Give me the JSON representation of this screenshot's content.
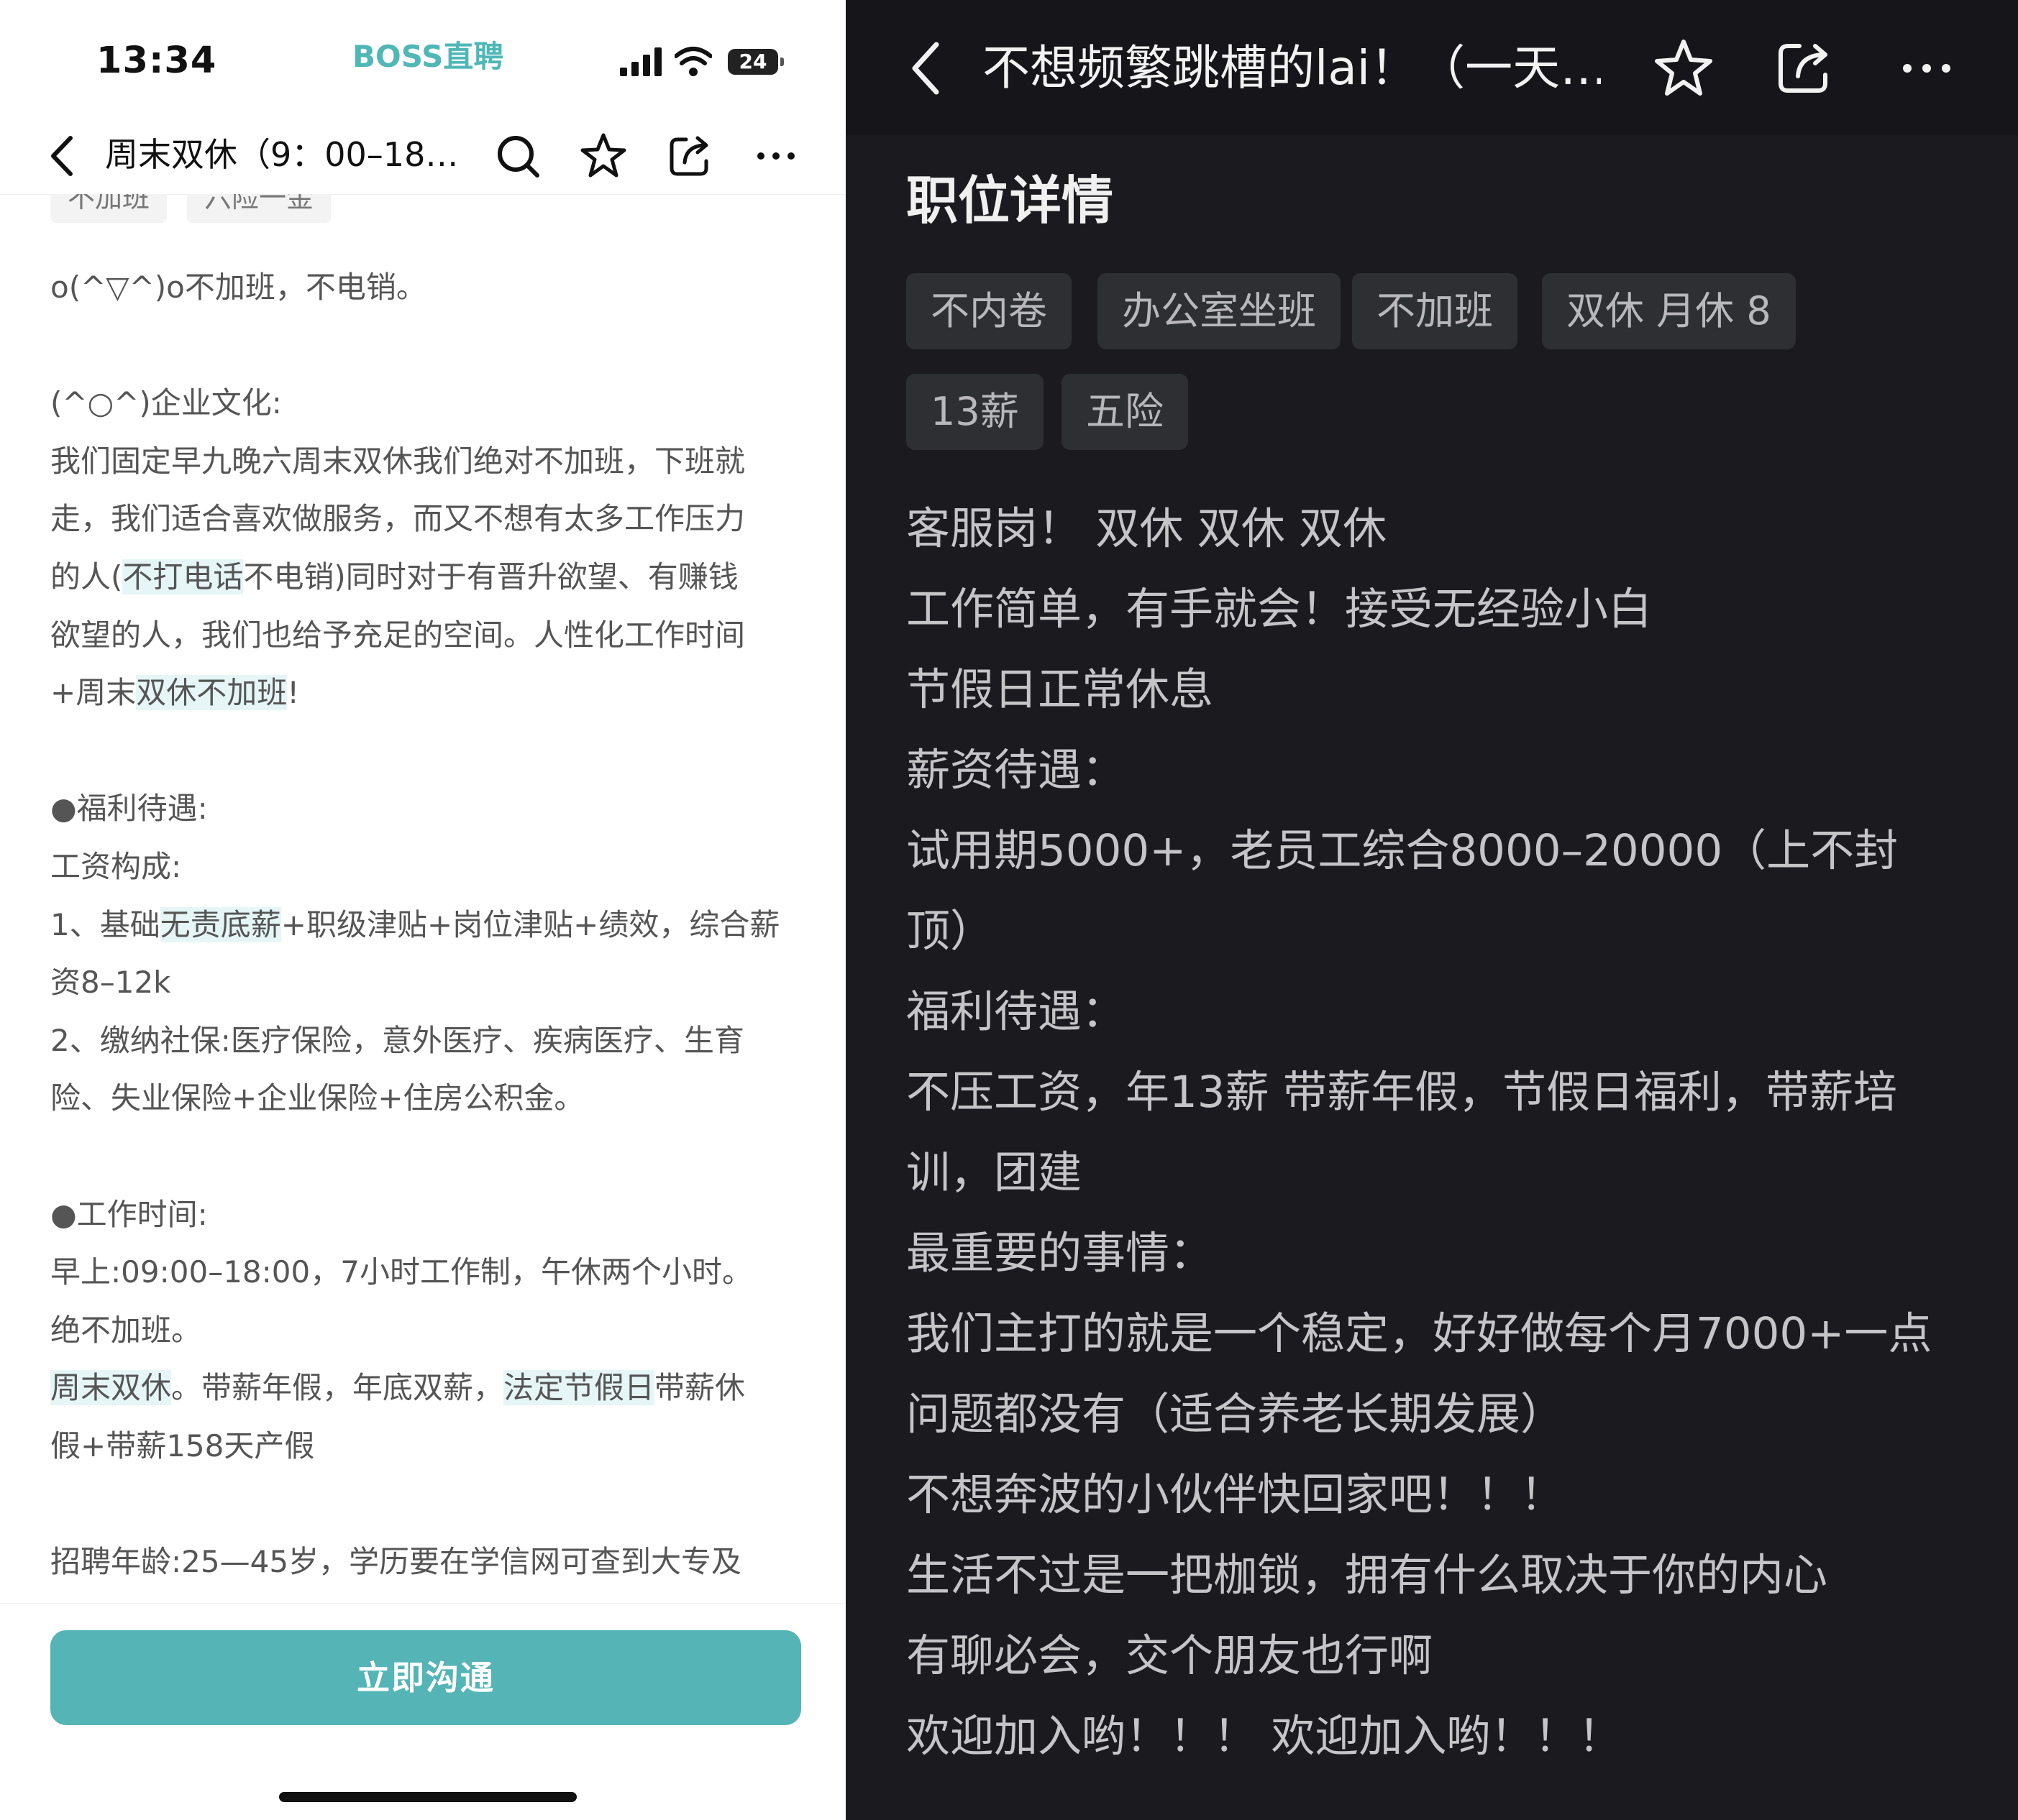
{
  "left": {
    "status_bar": {
      "time": "13:34",
      "brand": "BOSS直聘",
      "battery": "24"
    },
    "nav": {
      "title": "周末双休（9：00–18…"
    },
    "tags_partial": [
      "不加班",
      "六险一金"
    ],
    "lines": [
      "o(^▽^)o不加班，不电销。",
      "",
      "(^○^)企业文化:",
      "我们固定早九晚六周末双休我们绝对不加班，下班就",
      "走，我们适合喜欢做服务，而又不想有太多工作压力",
      "的人(不打电话不电销)同时对于有晋升欲望、有赚钱",
      "欲望的人，我们也给予充足的空间。人性化工作时间",
      "+周末双休不加班!",
      "",
      "●福利待遇:",
      "工资构成:",
      "1、基础无责底薪+职级津贴+岗位津贴+绩效，综合薪",
      "资8–12k",
      "2、缴纳社保:医疗保险，意外医疗、疾病医疗、生育",
      "险、失业保险+企业保险+住房公积金。",
      "",
      "●工作时间:",
      "早上:09:00–18:00，7小时工作制，午休两个小时。",
      "绝不加班。",
      "周末双休。带薪年假，年底双薪，法定节假日带薪休",
      "假+带薪158天产假",
      "",
      "招聘年龄:25—45岁，学历要在学信网可查到大专及"
    ],
    "highlights": {
      "h5a": "的人(",
      "h5b": "不打电话",
      "h5c": "不电销)同时对于有晋升欲望、有赚钱",
      "h7a": "+周末",
      "h7b": "双休不加班",
      "h7c": "!",
      "h11a": "1、基础",
      "h11b": "无责底薪",
      "h11c": "+职级津贴+岗位津贴+绩效，综合薪",
      "h19a": "周末双休",
      "h19b": "。带薪年假，年底双薪，",
      "h19c": "法定节假日",
      "h19d": "带薪休"
    },
    "button": {
      "label": "立即沟通"
    }
  },
  "right": {
    "nav": {
      "title": "不想频繁跳槽的lai！（一天…"
    },
    "section_title": "职位详情",
    "tags": [
      "不内卷",
      "办公室坐班",
      "不加班",
      "双休 月休 8",
      "13薪",
      "五险"
    ],
    "lines": [
      "客服岗！ 双休 双休 双休",
      "工作简单，有手就会！接受无经验小白",
      "节假日正常休息",
      "薪资待遇：",
      "试用期5000+，老员工综合8000–20000（上不封",
      "顶）",
      "福利待遇：",
      "不压工资，年13薪 带薪年假，节假日福利，带薪培",
      "训，团建",
      "最重要的事情：",
      "我们主打的就是一个稳定，好好做每个月7000+一点",
      "问题都没有（适合养老长期发展）",
      "不想奔波的小伙伴快回家吧！！！",
      "生活不过是一把枷锁，拥有什么取决于你的内心",
      "有聊必会，交个朋友也行啊",
      "欢迎加入哟！！！ 欢迎加入哟！！！"
    ]
  }
}
